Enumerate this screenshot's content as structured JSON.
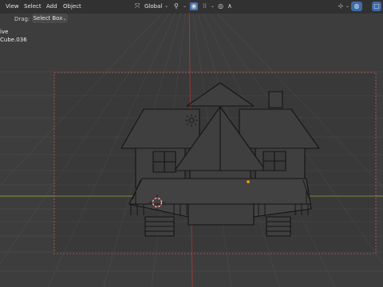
{
  "header": {
    "menu": [
      "View",
      "Select",
      "Add",
      "Object"
    ],
    "drag_label": "Drag:",
    "drag_value": "Select Box",
    "orientation": "Global",
    "chevron": "⌄"
  },
  "overlay": {
    "line1": "ive",
    "line2": "Cube.036"
  },
  "viewport": {
    "background": "#3d3d3d",
    "grid_color": "#484848",
    "x_axis_color": "#7f9a3a",
    "y_axis_color": "#9b3a3a",
    "camera_frame_color": "#c85a5a",
    "origin_color": "#ffa500"
  },
  "icons": {
    "cursor_tool": "cursor-icon",
    "pivot": "pivot-icon",
    "snap": "snap-magnet-icon",
    "proportional": "proportional-editing-icon",
    "falloff": "falloff-curve-icon",
    "gizmo": "gizmo-toggle-icon",
    "overlays": "overlays-icon",
    "xray": "xray-icon",
    "shading": "solid-shading-icon"
  }
}
